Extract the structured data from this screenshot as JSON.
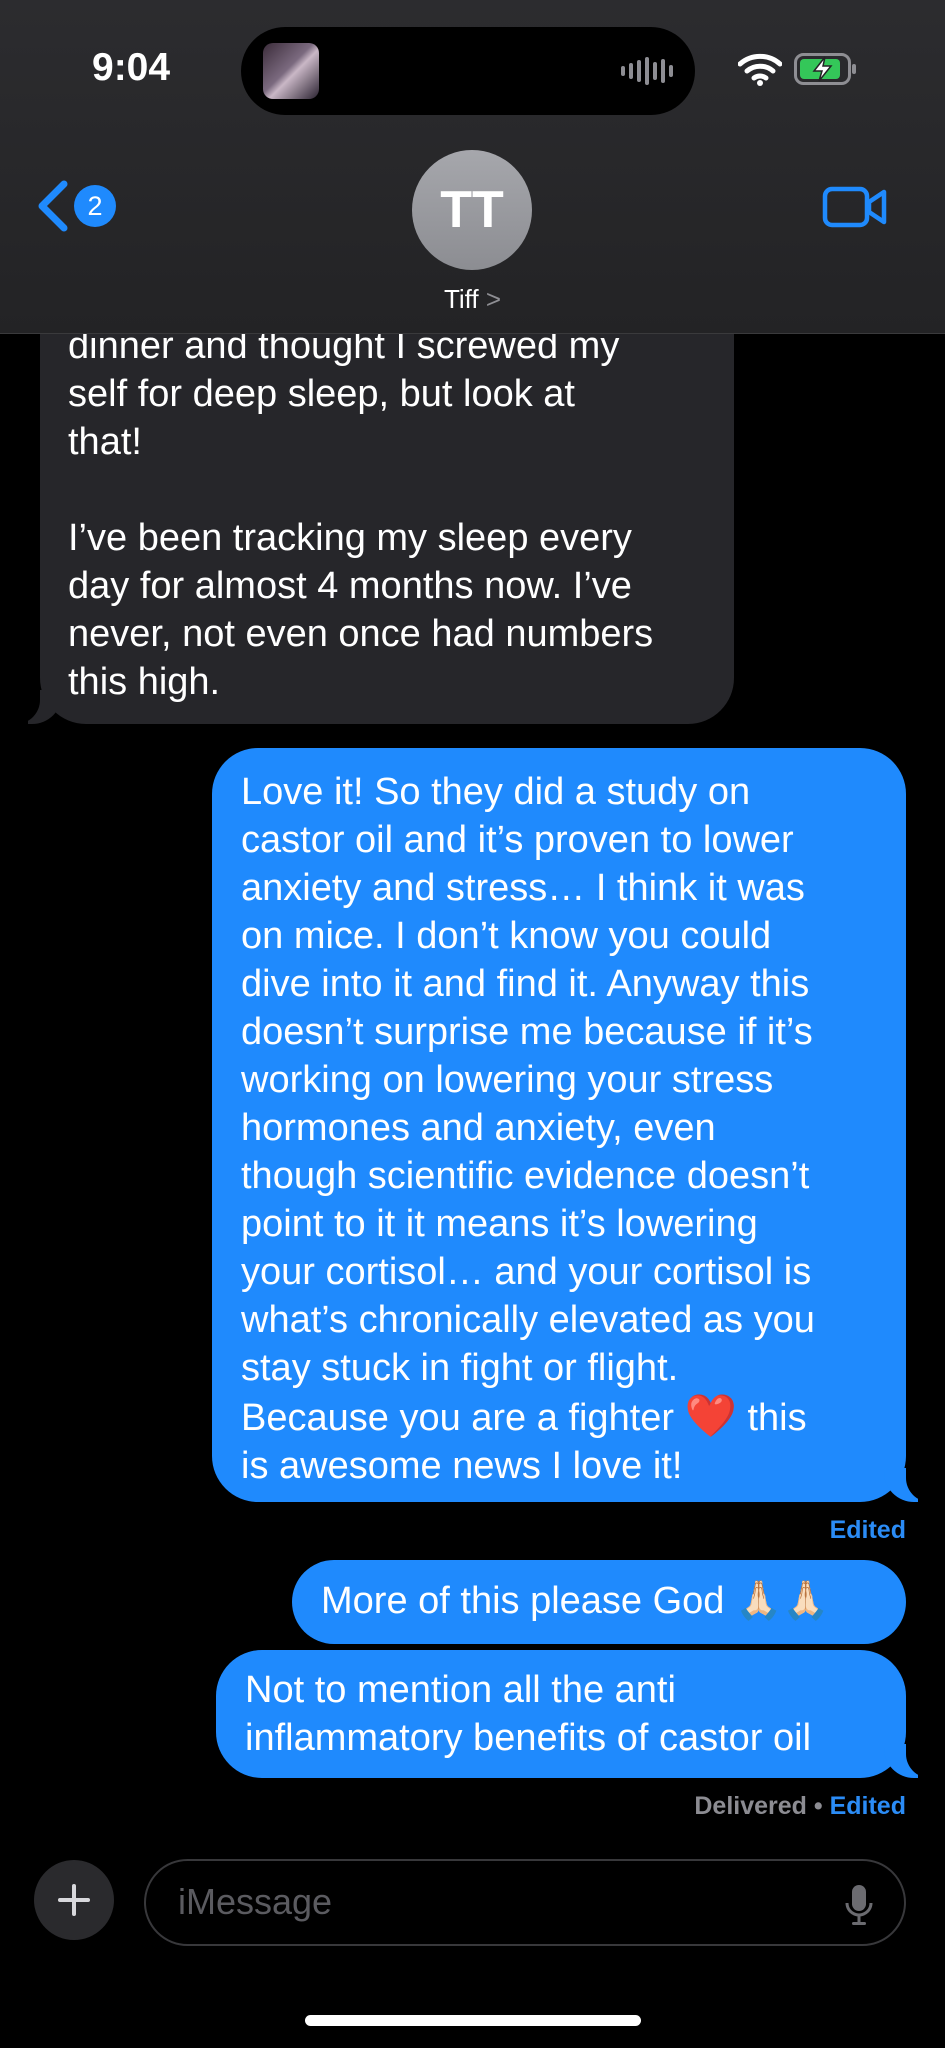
{
  "status_bar": {
    "time": "9:04"
  },
  "header": {
    "back_badge_count": "2",
    "avatar_initials": "TT",
    "contact_name": "Tiff",
    "contact_chevron": ">"
  },
  "messages": [
    {
      "direction": "received",
      "text": "dinner and thought I screwed my\nself for deep sleep, but look at\nthat!\n\nI’ve been tracking my sleep every\nday for almost 4 months now. I’ve\nnever, not even once had numbers\nthis high."
    },
    {
      "direction": "sent",
      "text_before_emoji": "Love it! So they did a study on\ncastor oil and it’s proven to lower\nanxiety and stress… I think it was\non mice. I don’t know you could\ndive into it and find it. Anyway this\ndoesn’t surprise me because if it’s\nworking on lowering your stress\nhormones and anxiety, even\nthough scientific evidence doesn’t\npoint to it it means it’s lowering\nyour cortisol… and your cortisol is\nwhat’s chronically elevated as you\nstay stuck in fight or flight.\nBecause you are a fighter ",
      "emoji": "❤️",
      "text_after_emoji": " this\nis awesome news I love it!",
      "status": "Edited"
    },
    {
      "direction": "sent",
      "text": "More of this please God 🙏🏻🙏🏻"
    },
    {
      "direction": "sent",
      "text": "Not to mention all the anti\ninflammatory benefits of castor oil",
      "status_delivered": "Delivered",
      "status_separator": " • ",
      "status_edited": "Edited"
    }
  ],
  "composer": {
    "placeholder": "iMessage"
  },
  "colors": {
    "sent_bubble": "#1f8afd",
    "received_bubble": "#26262a",
    "accent": "#2b8cf6",
    "background": "#000000"
  },
  "icons": [
    "back-chevron-icon",
    "video-camera-icon",
    "wifi-icon",
    "battery-charging-icon",
    "plus-icon",
    "microphone-icon"
  ]
}
